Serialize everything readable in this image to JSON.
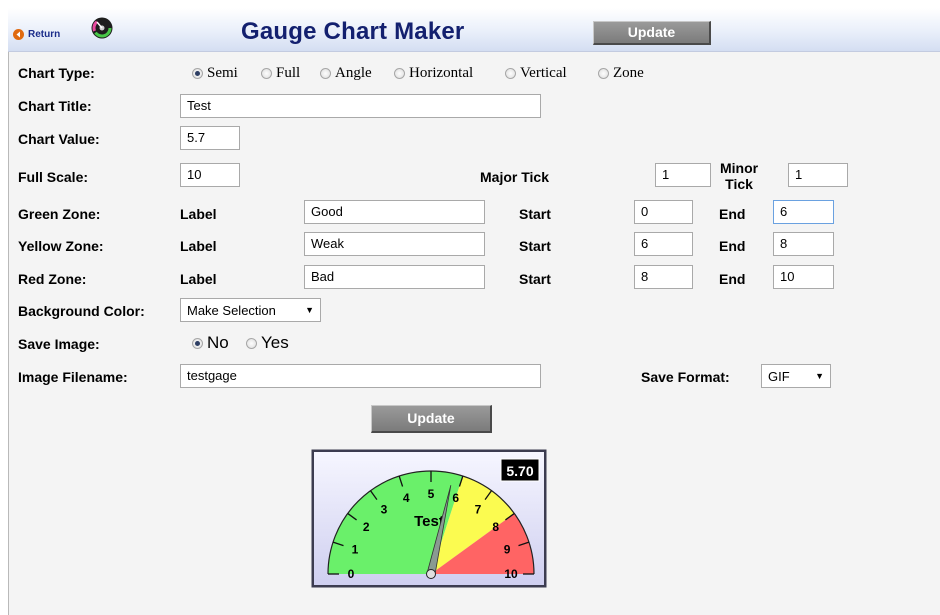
{
  "header": {
    "return_label": "Return",
    "title": "Gauge Chart Maker",
    "update_label": "Update"
  },
  "form": {
    "chart_type": {
      "label": "Chart Type:",
      "options": [
        "Semi",
        "Full",
        "Angle",
        "Horizontal",
        "Vertical",
        "Zone"
      ],
      "selected": "Semi"
    },
    "chart_title": {
      "label": "Chart Title:",
      "value": "Test"
    },
    "chart_value": {
      "label": "Chart Value:",
      "value": "5.7"
    },
    "full_scale": {
      "label": "Full Scale:",
      "value": "10",
      "major_tick_label": "Major Tick",
      "major_tick_value": "1",
      "minor_tick_label_1": "Minor",
      "minor_tick_label_2": "Tick",
      "minor_tick_value": "1"
    },
    "zone_words": {
      "label": "Label",
      "start": "Start",
      "end": "End"
    },
    "green_zone": {
      "label": "Green Zone:",
      "name": "Good",
      "start": "0",
      "end": "6"
    },
    "yellow_zone": {
      "label": "Yellow Zone:",
      "name": "Weak",
      "start": "6",
      "end": "8"
    },
    "red_zone": {
      "label": "Red Zone:",
      "name": "Bad",
      "start": "8",
      "end": "10"
    },
    "background_color": {
      "label": "Background Color:",
      "value": "Make Selection"
    },
    "save_image": {
      "label": "Save Image:",
      "options": [
        "No",
        "Yes"
      ],
      "selected": "No"
    },
    "image_filename": {
      "label": "Image Filename:",
      "value": "testgage"
    },
    "save_format": {
      "label": "Save Format:",
      "value": "GIF"
    },
    "update_label": "Update"
  },
  "gauge": {
    "title": "Test",
    "value": 5.7,
    "readout": "5.70",
    "scale_min": 0,
    "scale_max": 10,
    "tick_labels": [
      "0",
      "1",
      "2",
      "3",
      "4",
      "5",
      "6",
      "7",
      "8",
      "9",
      "10"
    ],
    "zones": [
      {
        "name": "Good",
        "start": 0,
        "end": 6,
        "color": "#6af06a"
      },
      {
        "name": "Weak",
        "start": 6,
        "end": 8,
        "color": "#fbfb50"
      },
      {
        "name": "Bad",
        "start": 8,
        "end": 10,
        "color": "#ff6464"
      }
    ],
    "background_color": "#dcdcf6",
    "needle_color": "#8a9a92"
  },
  "colors": {
    "title_blue": "#13206f",
    "button_gray": "#888888"
  }
}
